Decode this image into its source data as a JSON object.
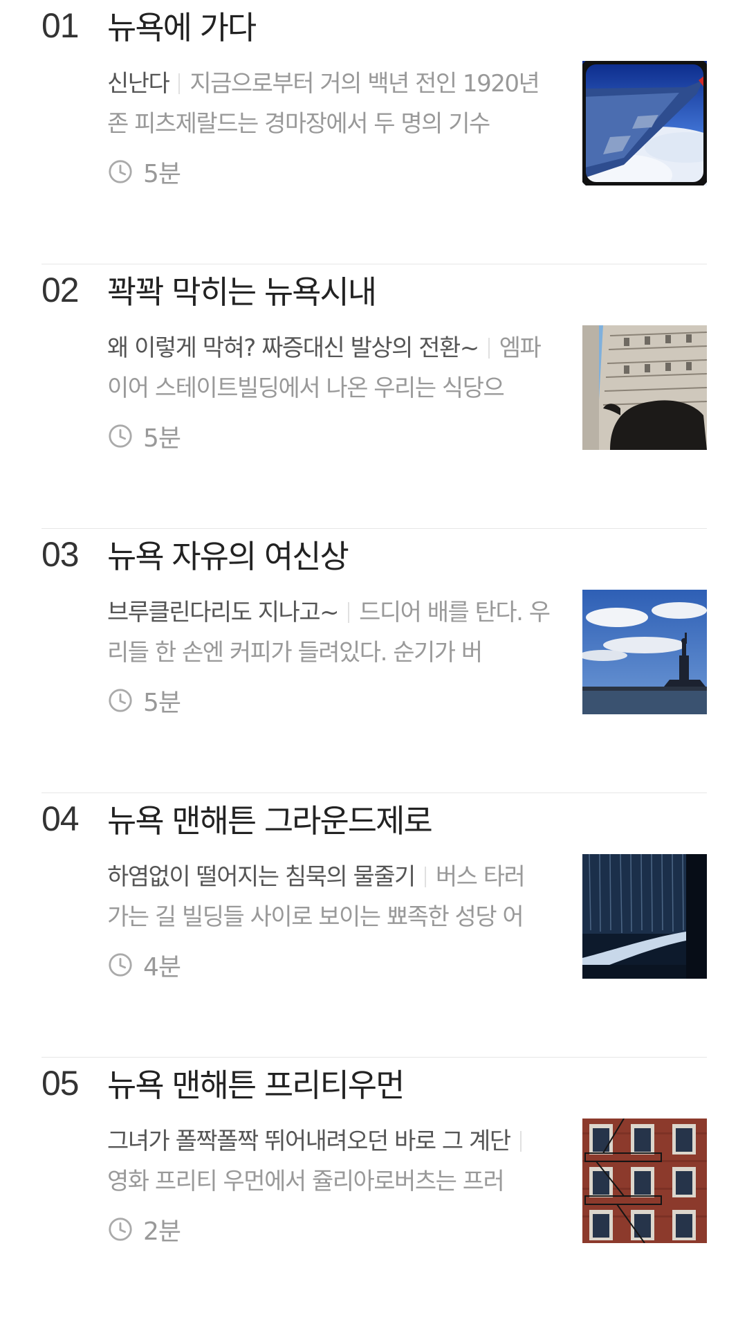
{
  "items": [
    {
      "number": "01",
      "title": "뉴욕에 가다",
      "lead": "신난다",
      "summary": "지금으로부터 거의 백년 전인 1920년 존 피츠제랄드는 경마장에서 두 명의 기수",
      "time": "5분",
      "image": "airplane-wing-over-clouds"
    },
    {
      "number": "02",
      "title": "꽉꽉 막히는 뉴욕시내",
      "lead": "왜 이렇게 막혀? 짜증대신 발상의 전환~",
      "summary": "엠파이어 스테이트빌딩에서 나온 우리는 식당으",
      "time": "5분",
      "image": "charging-bull-and-building"
    },
    {
      "number": "03",
      "title": "뉴욕 자유의 여신상",
      "lead": "브루클린다리도 지나고~",
      "summary": "드디어 배를 탄다. 우리들 한 손엔 커피가 들려있다. 순기가 버",
      "time": "5분",
      "image": "statue-of-liberty"
    },
    {
      "number": "04",
      "title": "뉴욕 맨해튼 그라운드제로",
      "lead": "하염없이 떨어지는 침묵의 물줄기",
      "summary": "버스 타러 가는 길 빌딩들 사이로 보이는 뾰족한 성당 어",
      "time": "4분",
      "image": "memorial-waterfall"
    },
    {
      "number": "05",
      "title": "뉴욕 맨해튼 프리티우먼",
      "lead": "그녀가 폴짝폴짝 뛰어내려오던 바로 그 계단",
      "summary": "영화 프리티 우먼에서 쥴리아로버츠는 프러",
      "time": "2분",
      "image": "brick-building-fire-escape"
    }
  ]
}
